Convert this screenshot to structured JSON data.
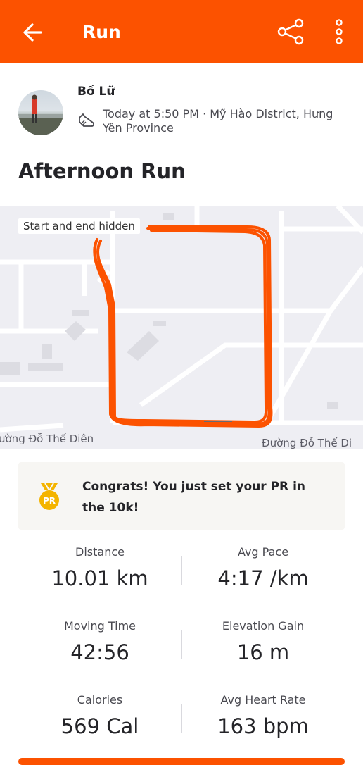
{
  "header": {
    "title": "Run"
  },
  "athlete": {
    "name": "Bố Lữ",
    "meta": "Today at 5:50 PM · Mỹ Hào District, Hưng Yên Province"
  },
  "activity": {
    "title": "Afternoon Run"
  },
  "map": {
    "badge": "Start and end hidden",
    "road_left": "ường Đỗ Thế Diên",
    "road_right": "Đường Đỗ Thế Di",
    "route_color": "#fc5200"
  },
  "pr": {
    "message": "Congrats! You just set your PR in the 10k!",
    "medal_label": "PR"
  },
  "stats": [
    {
      "left": {
        "label": "Distance",
        "value": "10.01 km"
      },
      "right": {
        "label": "Avg Pace",
        "value": "4:17 /km"
      }
    },
    {
      "left": {
        "label": "Moving Time",
        "value": "42:56"
      },
      "right": {
        "label": "Elevation Gain",
        "value": "16 m"
      }
    },
    {
      "left": {
        "label": "Calories",
        "value": "569 Cal"
      },
      "right": {
        "label": "Avg Heart Rate",
        "value": "163 bpm"
      }
    }
  ],
  "colors": {
    "accent": "#fc5200"
  },
  "icons": [
    "back-arrow-icon",
    "share-icon",
    "more-vertical-icon",
    "shoe-icon",
    "pr-medal-icon"
  ]
}
